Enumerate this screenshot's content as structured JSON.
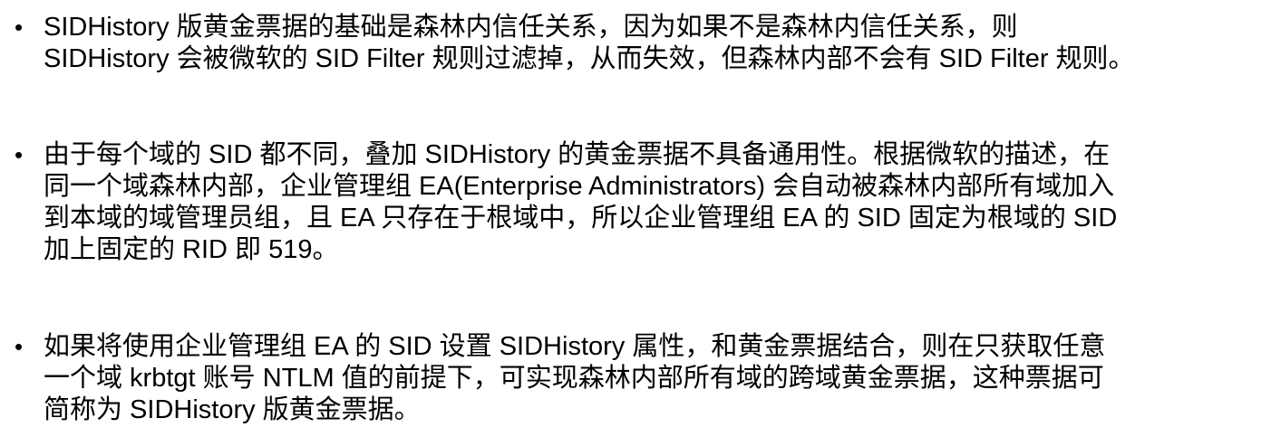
{
  "bullets": [
    {
      "marker": "•",
      "lines": [
        "SIDHistory 版黄金票据的基础是森林内信任关系，因为如果不是森林内信任关系，则",
        "SIDHistory 会被微软的 SID Filter 规则过滤掉，从而失效，但森林内部不会有 SID Filter 规则。"
      ]
    },
    {
      "marker": "•",
      "lines": [
        "由于每个域的 SID 都不同，叠加 SIDHistory 的黄金票据不具备通用性。根据微软的描述，在",
        "同一个域森林内部，企业管理组 EA(Enterprise Administrators) 会自动被森林内部所有域加入",
        "到本域的域管理员组，且 EA 只存在于根域中，所以企业管理组 EA 的 SID 固定为根域的 SID",
        "加上固定的 RID 即 519。"
      ]
    },
    {
      "marker": "•",
      "lines": [
        "如果将使用企业管理组 EA 的 SID 设置 SIDHistory 属性，和黄金票据结合，则在只获取任意",
        "一个域 krbtgt 账号 NTLM 值的前提下，可实现森林内部所有域的跨域黄金票据，这种票据可",
        "简称为 SIDHistory 版黄金票据。"
      ]
    }
  ]
}
